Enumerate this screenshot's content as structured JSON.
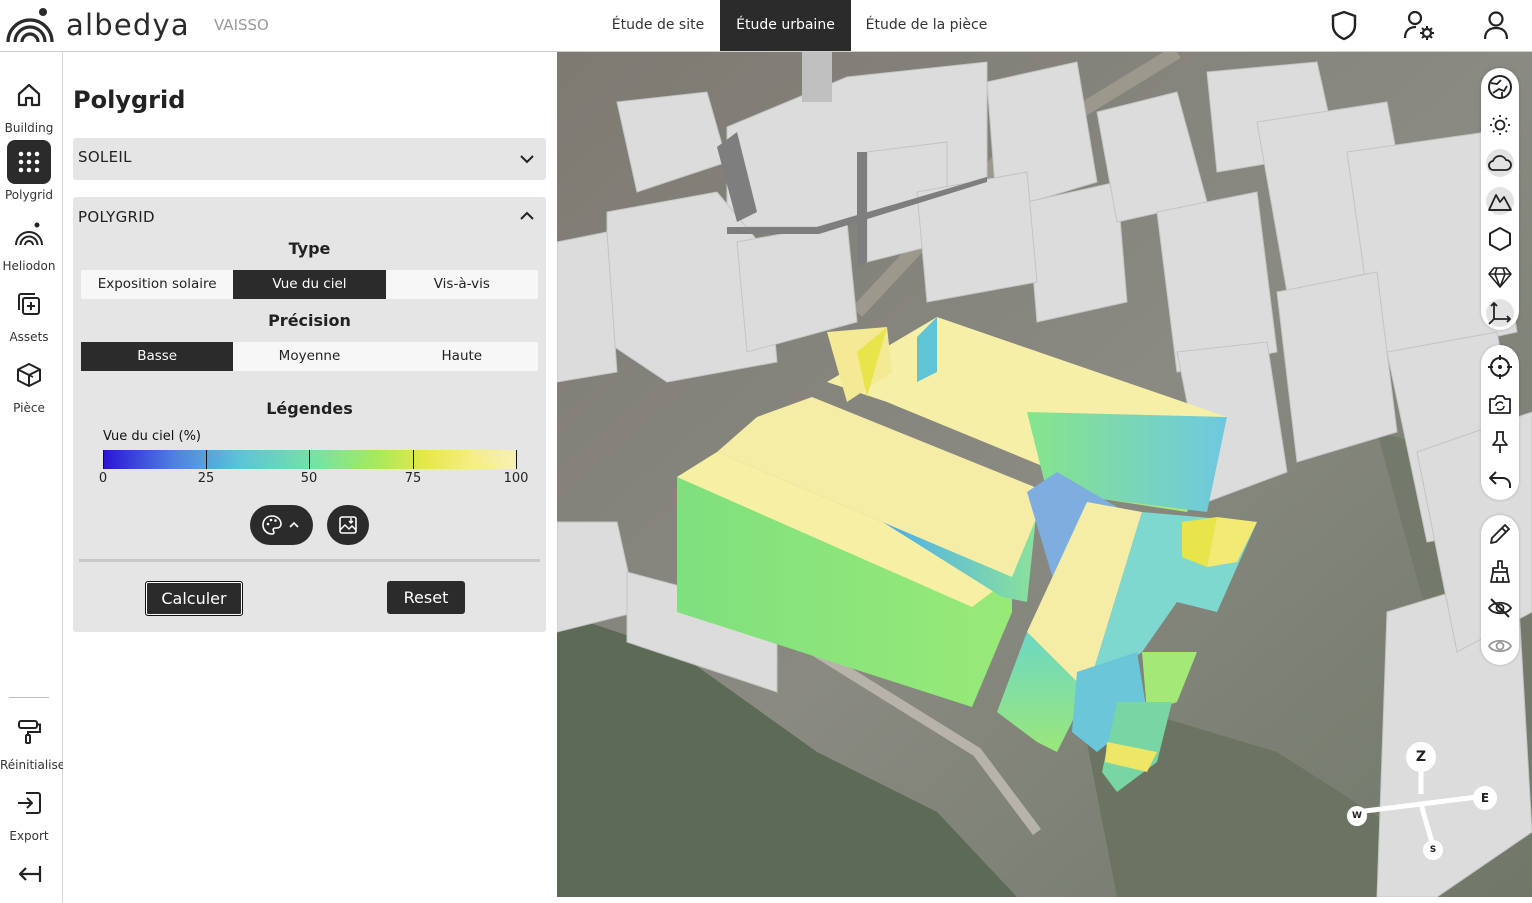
{
  "header": {
    "brand": "albedya",
    "project": "VAISSO",
    "tabs": [
      {
        "label": "Étude de site",
        "active": false
      },
      {
        "label": "Étude urbaine",
        "active": true
      },
      {
        "label": "Étude de la pièce",
        "active": false
      }
    ],
    "icons": [
      "shield-icon",
      "user-settings-icon",
      "user-icon"
    ]
  },
  "rail": {
    "items": [
      {
        "label": "Building",
        "icon": "home-icon",
        "active": false
      },
      {
        "label": "Polygrid",
        "icon": "grid-dots-icon",
        "active": true
      },
      {
        "label": "Heliodon",
        "icon": "heliodon-icon",
        "active": false
      },
      {
        "label": "Assets",
        "icon": "add-asset-icon",
        "active": false
      },
      {
        "label": "Pièce",
        "icon": "cube-icon",
        "active": false
      }
    ],
    "bottom": [
      {
        "label": "Réinitialiser",
        "icon": "paint-roller-icon"
      },
      {
        "label": "Export",
        "icon": "export-icon"
      }
    ],
    "collapse_icon": "collapse-left-icon"
  },
  "panel": {
    "title": "Polygrid",
    "soleil": {
      "label": "SOLEIL",
      "expanded": false
    },
    "polygrid": {
      "label": "POLYGRID",
      "expanded": true,
      "type_title": "Type",
      "type_options": [
        "Exposition solaire",
        "Vue du ciel",
        "Vis-à-vis"
      ],
      "type_selected": "Vue du ciel",
      "precision_title": "Précision",
      "precision_options": [
        "Basse",
        "Moyenne",
        "Haute"
      ],
      "precision_selected": "Basse",
      "legend_title": "Légendes",
      "legend_label": "Vue du ciel (%)",
      "legend_ticks": [
        "0",
        "25",
        "50",
        "75",
        "100"
      ],
      "palette_icon": "palette-icon",
      "export_image_icon": "image-export-icon",
      "calculate_label": "Calculer",
      "reset_label": "Reset"
    }
  },
  "map": {
    "compass": {
      "n": "Z",
      "e": "E",
      "w": "W",
      "s": "S"
    },
    "toolbar_top": [
      "globe-icon",
      "sun-icon",
      "cloud-icon",
      "terrain-icon",
      "hexagon-icon",
      "diamond-icon",
      "axes-icon"
    ],
    "toolbar_mid": [
      "target-icon",
      "camera-rotate-icon",
      "pin-icon",
      "undo-icon"
    ],
    "toolbar_bottom": [
      "pencil-icon",
      "brush-icon",
      "eye-off-icon",
      "eye-icon"
    ]
  },
  "colors": {
    "dark": "#2b2b2b",
    "panel_bg": "#e5e5e5"
  }
}
